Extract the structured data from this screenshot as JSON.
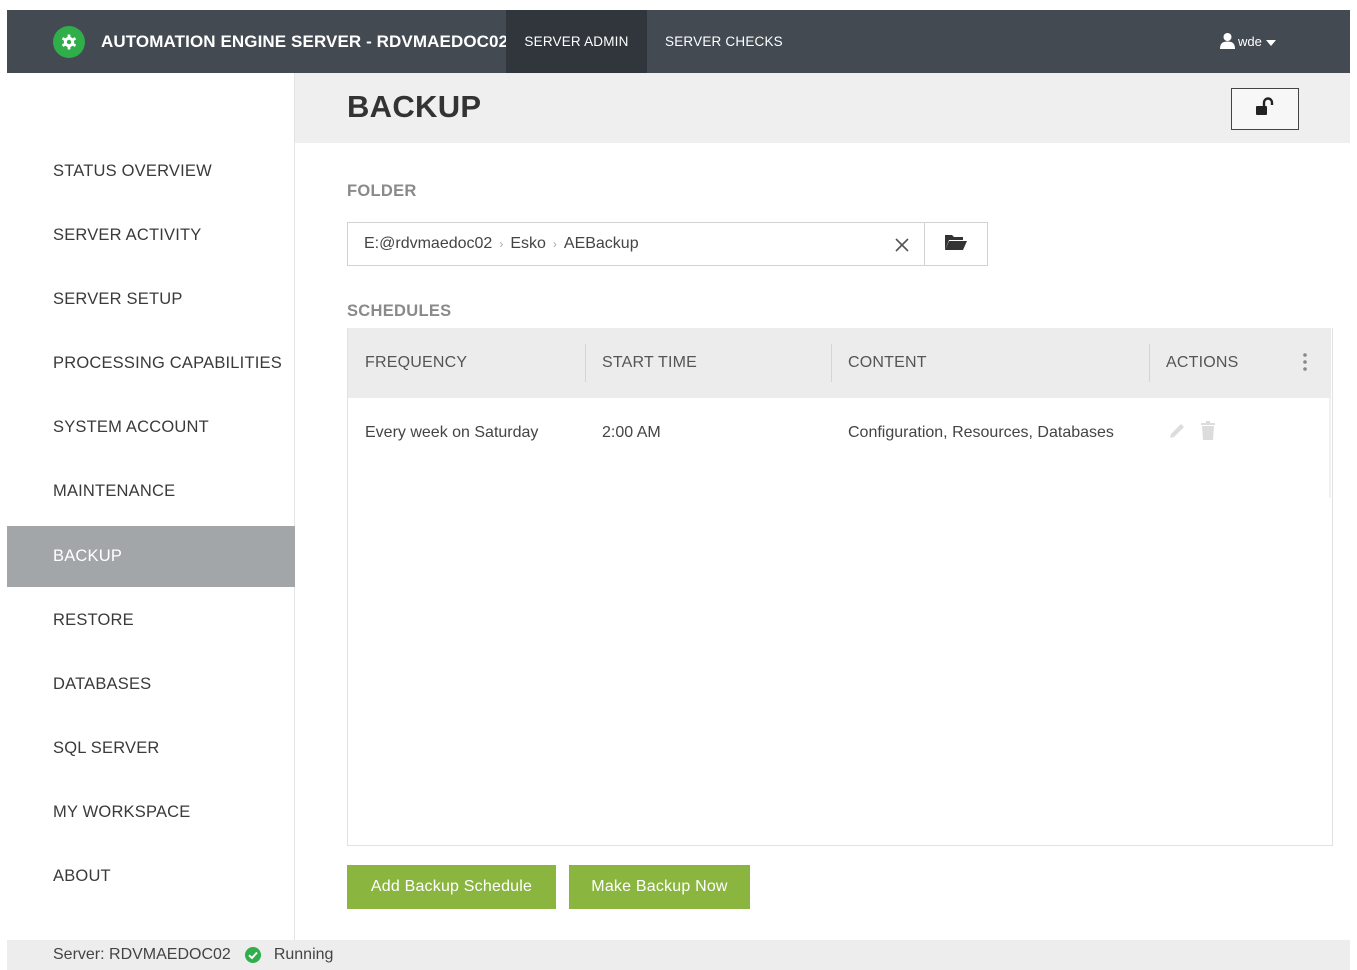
{
  "header": {
    "app_title": "AUTOMATION ENGINE SERVER - RDVMAEDOC02",
    "tabs": [
      {
        "label": "SERVER ADMIN",
        "active": true
      },
      {
        "label": "SERVER CHECKS",
        "active": false
      }
    ],
    "user": "wde",
    "brand_icon": "gear-icon",
    "colors": {
      "topbar": "#434a52",
      "active_tab": "#30363c",
      "brand_green": "#2fae4a"
    }
  },
  "sidebar": {
    "items": [
      {
        "label": "STATUS OVERVIEW",
        "active": false
      },
      {
        "label": "SERVER ACTIVITY",
        "active": false
      },
      {
        "label": "SERVER SETUP",
        "active": false
      },
      {
        "label": "PROCESSING CAPABILITIES",
        "active": false
      },
      {
        "label": "SYSTEM ACCOUNT",
        "active": false
      },
      {
        "label": "MAINTENANCE",
        "active": false
      },
      {
        "label": "BACKUP",
        "active": true
      },
      {
        "label": "RESTORE",
        "active": false
      },
      {
        "label": "DATABASES",
        "active": false
      },
      {
        "label": "SQL SERVER",
        "active": false
      },
      {
        "label": "MY WORKSPACE",
        "active": false
      },
      {
        "label": "ABOUT",
        "active": false
      }
    ],
    "active_color": "#a3a6a9"
  },
  "page": {
    "title": "BACKUP",
    "lock_icon": "unlock-icon"
  },
  "folder": {
    "label": "FOLDER",
    "path": [
      "E:@rdvmaedoc02",
      "Esko",
      "AEBackup"
    ],
    "separator": "›",
    "clear_icon": "close-icon",
    "browse_icon": "folder-open-icon"
  },
  "schedules": {
    "label": "SCHEDULES",
    "columns": [
      "FREQUENCY",
      "START TIME",
      "CONTENT",
      "ACTIONS"
    ],
    "rows": [
      {
        "frequency": "Every week on Saturday",
        "start_time": "2:00 AM",
        "content": "Configuration, Resources, Databases"
      }
    ],
    "row_action_icons": [
      "pencil-icon",
      "trash-icon"
    ]
  },
  "buttons": {
    "add_schedule": "Add Backup Schedule",
    "backup_now": "Make Backup Now",
    "color": "#8ab63f"
  },
  "status": {
    "server_label": "Server: RDVMAEDOC02",
    "state": "Running",
    "state_icon": "check-circle-icon",
    "state_color": "#2fae4a"
  }
}
